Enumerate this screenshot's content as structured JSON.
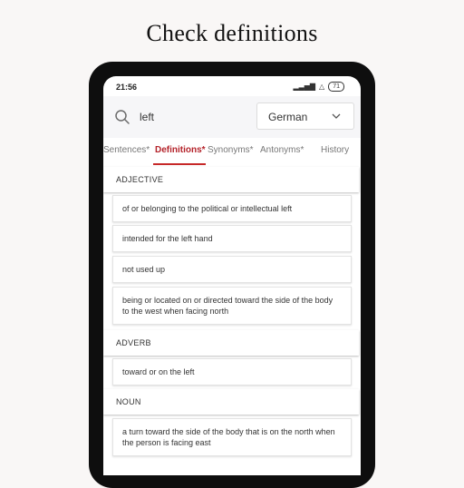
{
  "caption": "Check definitions",
  "status_bar": {
    "time": "21:56",
    "signal": "▂▃▅▇",
    "wifi": "△",
    "battery": "71"
  },
  "search": {
    "query": "left",
    "language": "German"
  },
  "tabs": [
    {
      "label": "Sentences*",
      "active": false
    },
    {
      "label": "Definitions*",
      "active": true
    },
    {
      "label": "Synonyms*",
      "active": false
    },
    {
      "label": "Antonyms*",
      "active": false
    },
    {
      "label": "History",
      "active": false
    }
  ],
  "sections": [
    {
      "pos": "ADJECTIVE",
      "definitions": [
        "of or belonging to the political or intellectual left",
        "intended for the left hand",
        "not used up",
        "being or located on or directed toward the side of the body to the west when facing north"
      ]
    },
    {
      "pos": "ADVERB",
      "definitions": [
        "toward or on the left"
      ]
    },
    {
      "pos": "NOUN",
      "definitions": [
        "a turn toward the side of the body that is on the north when the person is facing east"
      ]
    }
  ],
  "colors": {
    "accent": "#c62828",
    "background": "#f9f7f6",
    "phone_frame": "#0e0e0e"
  }
}
